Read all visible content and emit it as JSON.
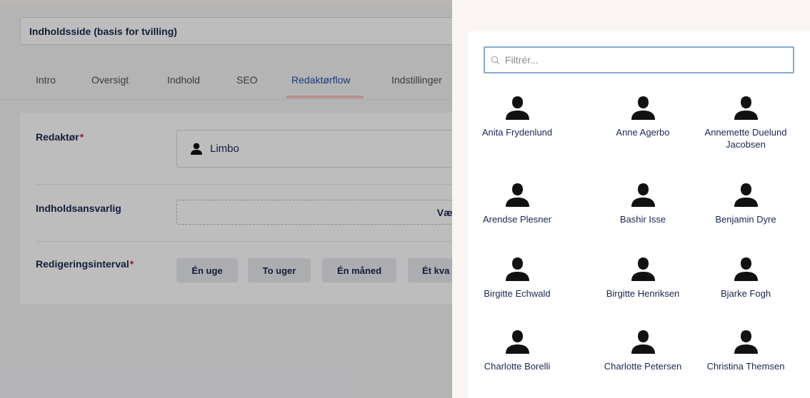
{
  "editor": {
    "page_name": "Indholdsside (basis for tvilling)",
    "tabs": [
      {
        "label": "Intro",
        "active": false
      },
      {
        "label": "Oversigt",
        "active": false
      },
      {
        "label": "Indhold",
        "active": false
      },
      {
        "label": "SEO",
        "active": false
      },
      {
        "label": "Redaktørflow",
        "active": true
      },
      {
        "label": "Indstillinger",
        "active": false
      }
    ],
    "fields": {
      "editor_label": "Redaktør",
      "editor_required": "*",
      "editor_value": "Limbo",
      "responsible_label": "Indholdsansvarlig",
      "responsible_button": "Vælg",
      "interval_label": "Redigeringsinterval",
      "interval_required": "*",
      "interval_options": [
        "Én uge",
        "To uger",
        "Én måned",
        "Ét kva"
      ]
    }
  },
  "picker": {
    "filter_placeholder": "Filtrér...",
    "users": [
      {
        "name": "Anita Frydenlund",
        "icon": "user-icon"
      },
      {
        "name": "Anne Agerbo",
        "icon": "user-icon"
      },
      {
        "name": "Annemette Duelund Jacobsen",
        "icon": "user-icon"
      },
      {
        "name": "Arendse Plesner",
        "icon": "user-icon"
      },
      {
        "name": "Bashir Isse",
        "icon": "user-icon"
      },
      {
        "name": "Benjamin Dyre",
        "icon": "user-icon"
      },
      {
        "name": "Birgitte Echwald",
        "icon": "user-icon"
      },
      {
        "name": "Birgitte Henriksen",
        "icon": "user-icon"
      },
      {
        "name": "Bjarke Fogh",
        "icon": "user-icon"
      },
      {
        "name": "Charlotte Borelli",
        "icon": "user-icon"
      },
      {
        "name": "Charlotte Petersen",
        "icon": "user-icon"
      },
      {
        "name": "Christina Themsen",
        "icon": "user-icon"
      }
    ]
  },
  "colors": {
    "accent": "#2152a3",
    "required": "#d42054",
    "tab_underline": "#f5c1bc",
    "filter_border": "#86a8d2",
    "text_dark": "#1b264f"
  }
}
